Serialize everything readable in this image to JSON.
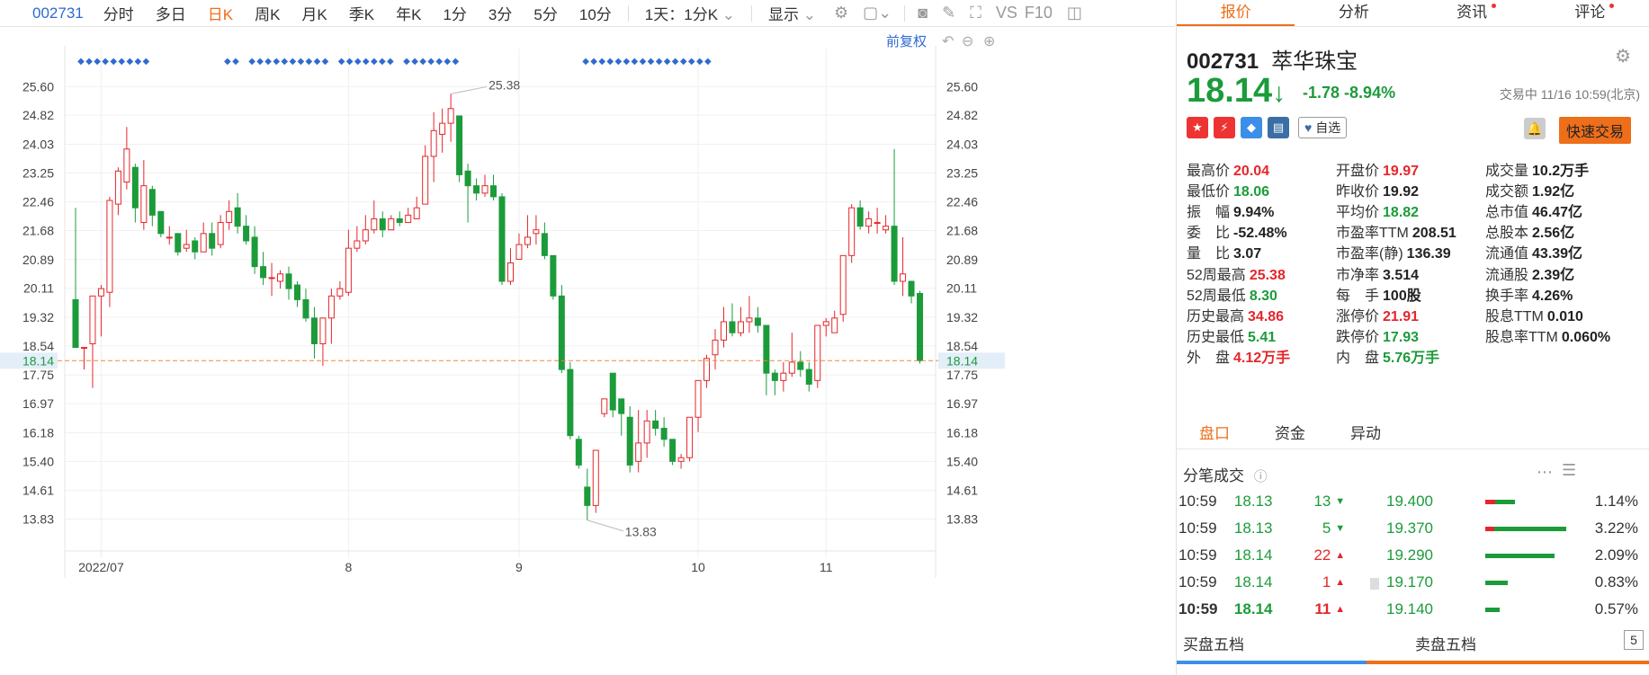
{
  "toolbar": {
    "code": "002731",
    "items": [
      "分时",
      "多日",
      "日K",
      "周K",
      "月K",
      "季K",
      "年K",
      "1分",
      "3分",
      "5分",
      "10分"
    ],
    "active": "日K",
    "period": "1天：1分K",
    "display": "显示",
    "vs": "VS",
    "f10": "F10"
  },
  "chart": {
    "restore": "前复权",
    "current_price": "18.14",
    "annotation_high": "25.38",
    "annotation_low": "13.83",
    "y_ticks": [
      "25.60",
      "24.82",
      "24.03",
      "23.25",
      "22.46",
      "21.68",
      "20.89",
      "20.11",
      "19.32",
      "18.54",
      "17.75",
      "16.97",
      "16.18",
      "15.40",
      "14.61",
      "13.83"
    ],
    "x_ticks": [
      "2022/07",
      "8",
      "9",
      "10",
      "11"
    ]
  },
  "chart_data": {
    "type": "candlestick",
    "ylim": [
      13.5,
      25.9
    ],
    "current": 18.14,
    "candles": [
      [
        19.8,
        18.5,
        22.3,
        18.5
      ],
      [
        18.5,
        18.5,
        18.5,
        17.9
      ],
      [
        18.6,
        19.9,
        19.9,
        17.4
      ],
      [
        19.9,
        20.1,
        20.2,
        18.8
      ],
      [
        20.0,
        22.5,
        22.6,
        19.6
      ],
      [
        22.4,
        23.3,
        23.4,
        22.1
      ],
      [
        23.0,
        23.9,
        24.5,
        22.8
      ],
      [
        23.4,
        22.3,
        23.5,
        21.9
      ],
      [
        21.9,
        22.9,
        23.6,
        21.7
      ],
      [
        22.8,
        22.1,
        22.9,
        21.8
      ],
      [
        22.2,
        21.6,
        22.2,
        21.5
      ],
      [
        21.5,
        21.5,
        21.8,
        21.3
      ],
      [
        21.6,
        21.1,
        21.6,
        21.0
      ],
      [
        21.2,
        21.3,
        21.7,
        21.1
      ],
      [
        21.4,
        21.1,
        21.5,
        20.9
      ],
      [
        21.1,
        21.6,
        21.9,
        21.1
      ],
      [
        21.6,
        21.2,
        21.9,
        21.0
      ],
      [
        21.3,
        21.9,
        22.1,
        21.2
      ],
      [
        21.9,
        22.2,
        22.5,
        21.7
      ],
      [
        22.3,
        21.8,
        22.7,
        21.6
      ],
      [
        21.8,
        21.4,
        22.1,
        21.3
      ],
      [
        21.5,
        20.7,
        21.8,
        20.5
      ],
      [
        20.7,
        20.4,
        21.1,
        20.2
      ],
      [
        20.4,
        20.4,
        20.8,
        19.9
      ],
      [
        20.3,
        20.5,
        20.6,
        20.1
      ],
      [
        20.5,
        20.1,
        20.7,
        19.8
      ],
      [
        20.2,
        19.8,
        20.3,
        19.6
      ],
      [
        19.8,
        19.3,
        20.1,
        19.2
      ],
      [
        19.3,
        18.6,
        19.6,
        18.2
      ],
      [
        18.6,
        19.3,
        19.3,
        18.0
      ],
      [
        19.3,
        19.9,
        20.1,
        18.6
      ],
      [
        19.9,
        20.1,
        20.3,
        19.8
      ],
      [
        20.0,
        21.2,
        21.7,
        19.9
      ],
      [
        21.2,
        21.4,
        21.8,
        21.1
      ],
      [
        21.4,
        21.7,
        22.1,
        21.3
      ],
      [
        21.7,
        22.0,
        22.5,
        21.6
      ],
      [
        22.0,
        21.7,
        22.2,
        21.5
      ],
      [
        21.7,
        22.0,
        22.1,
        21.8
      ],
      [
        22.0,
        21.9,
        22.2,
        21.8
      ],
      [
        21.9,
        22.1,
        22.3,
        21.9
      ],
      [
        22.0,
        22.3,
        22.6,
        22.0
      ],
      [
        22.4,
        23.7,
        24.0,
        22.4
      ],
      [
        23.7,
        24.4,
        24.9,
        23.0
      ],
      [
        24.3,
        24.6,
        25.0,
        23.8
      ],
      [
        24.6,
        25.0,
        25.4,
        24.1
      ],
      [
        24.8,
        23.2,
        24.8,
        23.0
      ],
      [
        23.3,
        22.9,
        23.5,
        21.9
      ],
      [
        22.9,
        22.7,
        23.1,
        22.5
      ],
      [
        22.7,
        22.9,
        23.2,
        22.6
      ],
      [
        22.9,
        22.6,
        23.2,
        22.5
      ],
      [
        22.6,
        20.3,
        22.7,
        20.2
      ],
      [
        20.3,
        20.8,
        21.2,
        20.2
      ],
      [
        20.9,
        21.3,
        21.6,
        20.9
      ],
      [
        21.3,
        21.5,
        22.1,
        21.2
      ],
      [
        21.6,
        21.7,
        22.1,
        21.3
      ],
      [
        21.6,
        21.0,
        21.9,
        20.9
      ],
      [
        21.0,
        19.9,
        21.0,
        19.8
      ],
      [
        19.9,
        17.9,
        20.2,
        17.8
      ],
      [
        17.9,
        16.1,
        18.1,
        16.0
      ],
      [
        16.0,
        15.3,
        16.1,
        15.2
      ],
      [
        14.7,
        14.2,
        15.2,
        13.8
      ],
      [
        14.2,
        15.7,
        15.7,
        14.0
      ],
      [
        16.7,
        17.1,
        17.1,
        16.6
      ],
      [
        17.8,
        16.8,
        17.8,
        16.6
      ],
      [
        17.1,
        16.7,
        17.1,
        16.1
      ],
      [
        16.6,
        15.3,
        16.9,
        15.1
      ],
      [
        15.4,
        15.9,
        16.8,
        15.1
      ],
      [
        15.9,
        16.5,
        16.8,
        15.5
      ],
      [
        16.5,
        16.3,
        16.8,
        16.1
      ],
      [
        16.3,
        16.0,
        16.6,
        15.8
      ],
      [
        16.0,
        15.4,
        16.0,
        15.3
      ],
      [
        15.4,
        15.5,
        15.6,
        15.2
      ],
      [
        15.5,
        16.6,
        16.6,
        15.4
      ],
      [
        16.6,
        17.6,
        17.6,
        16.2
      ],
      [
        17.6,
        18.2,
        18.3,
        17.4
      ],
      [
        18.3,
        18.7,
        19.0,
        17.9
      ],
      [
        18.7,
        19.2,
        19.6,
        18.5
      ],
      [
        19.2,
        18.9,
        19.7,
        18.8
      ],
      [
        18.9,
        19.2,
        19.6,
        18.8
      ],
      [
        19.2,
        19.3,
        19.9,
        18.9
      ],
      [
        19.3,
        19.1,
        19.6,
        18.9
      ],
      [
        19.1,
        17.8,
        19.1,
        17.2
      ],
      [
        17.8,
        17.6,
        17.9,
        17.2
      ],
      [
        17.6,
        17.8,
        18.1,
        17.3
      ],
      [
        17.8,
        18.1,
        18.9,
        17.7
      ],
      [
        18.1,
        17.9,
        18.4,
        17.7
      ],
      [
        17.9,
        17.5,
        18.1,
        17.3
      ],
      [
        17.6,
        19.1,
        19.1,
        17.4
      ],
      [
        19.1,
        19.2,
        19.3,
        18.8
      ],
      [
        18.9,
        19.3,
        19.5,
        18.9
      ],
      [
        19.4,
        21.0,
        21.0,
        19.2
      ],
      [
        21.0,
        22.3,
        22.4,
        20.8
      ],
      [
        22.3,
        21.8,
        22.5,
        21.7
      ],
      [
        21.8,
        22.0,
        22.2,
        21.6
      ],
      [
        21.9,
        21.9,
        22.3,
        21.6
      ],
      [
        21.7,
        21.8,
        22.1,
        21.6
      ],
      [
        21.8,
        20.3,
        23.9,
        20.2
      ],
      [
        20.3,
        20.5,
        21.5,
        19.9
      ],
      [
        20.3,
        19.9,
        20.3,
        19.7
      ],
      [
        19.97,
        18.14,
        20.04,
        18.06
      ]
    ],
    "marker_bars": [
      0,
      1,
      2,
      3,
      4,
      5,
      6,
      7,
      8,
      18,
      19,
      21,
      22,
      23,
      24,
      25,
      26,
      27,
      28,
      29,
      30,
      32,
      33,
      34,
      35,
      36,
      37,
      38,
      40,
      41,
      42,
      43,
      44,
      45,
      46,
      62,
      63,
      64,
      65,
      66,
      67,
      68,
      69,
      70,
      71,
      72,
      73,
      74,
      75,
      76,
      77
    ]
  },
  "tabs": [
    {
      "label": "报价",
      "active": true,
      "dot": false
    },
    {
      "label": "分析",
      "active": false,
      "dot": false
    },
    {
      "label": "资讯",
      "active": false,
      "dot": true
    },
    {
      "label": "评论",
      "active": false,
      "dot": true
    }
  ],
  "stock": {
    "code": "002731",
    "name": "萃华珠宝",
    "price": "18.14",
    "arrow": "↓",
    "change": "-1.78",
    "pct": "-8.94%",
    "time": "交易中 11/16 10:59(北京)",
    "watch": "自选",
    "quick": "快速交易",
    "icons": [
      {
        "icon": "cn-flag-icon",
        "color": "#e33",
        "glyph": "★"
      },
      {
        "icon": "runner-icon",
        "color": "#e33",
        "glyph": "⚡"
      },
      {
        "icon": "tag-icon",
        "color": "#3b8fe8",
        "glyph": "◆"
      },
      {
        "icon": "note-icon",
        "color": "#3a6ea5",
        "glyph": "▤"
      }
    ]
  },
  "stats": [
    [
      {
        "k": "最高价",
        "v": "20.04",
        "c": "up"
      },
      {
        "k": "开盘价",
        "v": "19.97",
        "c": "up"
      },
      {
        "k": "成交量",
        "v": "10.2万手",
        "c": "nm"
      }
    ],
    [
      {
        "k": "最低价",
        "v": "18.06",
        "c": "dn"
      },
      {
        "k": "昨收价",
        "v": "19.92",
        "c": "nm"
      },
      {
        "k": "成交额",
        "v": "1.92亿",
        "c": "nm"
      }
    ],
    [
      {
        "k": "振　幅",
        "v": "9.94%",
        "c": "nm"
      },
      {
        "k": "平均价",
        "v": "18.82",
        "c": "dn"
      },
      {
        "k": "总市值",
        "v": "46.47亿",
        "c": "nm"
      }
    ],
    [
      {
        "k": "委　比",
        "v": "-52.48%",
        "c": "nm"
      },
      {
        "k": "市盈率TTM",
        "v": "208.51",
        "c": "nm"
      },
      {
        "k": "总股本",
        "v": "2.56亿",
        "c": "nm"
      }
    ],
    [
      {
        "k": "量　比",
        "v": "3.07",
        "c": "nm"
      },
      {
        "k": "市盈率(静)",
        "v": "136.39",
        "c": "nm"
      },
      {
        "k": "流通值",
        "v": "43.39亿",
        "c": "nm"
      }
    ],
    [
      {
        "k": "52周最高",
        "v": "25.38",
        "c": "up"
      },
      {
        "k": "市净率",
        "v": "3.514",
        "c": "nm"
      },
      {
        "k": "流通股",
        "v": "2.39亿",
        "c": "nm"
      }
    ],
    [
      {
        "k": "52周最低",
        "v": "8.30",
        "c": "dn"
      },
      {
        "k": "每　手",
        "v": "100股",
        "c": "nm"
      },
      {
        "k": "换手率",
        "v": "4.26%",
        "c": "nm"
      }
    ],
    [
      {
        "k": "历史最高",
        "v": "34.86",
        "c": "up"
      },
      {
        "k": "涨停价",
        "v": "21.91",
        "c": "up"
      },
      {
        "k": "股息TTM",
        "v": "0.010",
        "c": "nm"
      }
    ],
    [
      {
        "k": "历史最低",
        "v": "5.41",
        "c": "dn"
      },
      {
        "k": "跌停价",
        "v": "17.93",
        "c": "dn"
      },
      {
        "k": "股息率TTM",
        "v": "0.060%",
        "c": "nm"
      }
    ],
    [
      {
        "k": "外　盘",
        "v": "4.12万手",
        "c": "up"
      },
      {
        "k": "内　盘",
        "v": "5.76万手",
        "c": "dn"
      },
      {
        "k": "",
        "v": "",
        "c": "nm"
      }
    ]
  ],
  "subtabs": [
    "盘口",
    "资金",
    "异动"
  ],
  "tick_title": "分笔成交",
  "trades": [
    {
      "t": "10:59",
      "p": "18.13",
      "v": "13",
      "dir": "down"
    },
    {
      "t": "10:59",
      "p": "18.13",
      "v": "5",
      "dir": "down"
    },
    {
      "t": "10:59",
      "p": "18.14",
      "v": "22",
      "dir": "up"
    },
    {
      "t": "10:59",
      "p": "18.14",
      "v": "1",
      "dir": "up"
    },
    {
      "t": "10:59",
      "p": "18.14",
      "v": "11",
      "dir": "up"
    }
  ],
  "depth": [
    {
      "p": "19.400",
      "pct": "1.14%",
      "red": 0.12,
      "green": 0.25
    },
    {
      "p": "19.370",
      "pct": "3.22%",
      "red": 0.12,
      "green": 0.95
    },
    {
      "p": "19.290",
      "pct": "2.09%",
      "red": 0,
      "green": 0.85
    },
    {
      "p": "19.170",
      "pct": "0.83%",
      "red": 0,
      "green": 0.28
    },
    {
      "p": "19.140",
      "pct": "0.57%",
      "red": 0,
      "green": 0.18
    }
  ],
  "five": {
    "buy": "买盘五档",
    "sell": "卖盘五档",
    "n": "5",
    "buy_pct": "40.13%",
    "sell_pct": "59.87%",
    "buy_frac": 0.4013
  }
}
